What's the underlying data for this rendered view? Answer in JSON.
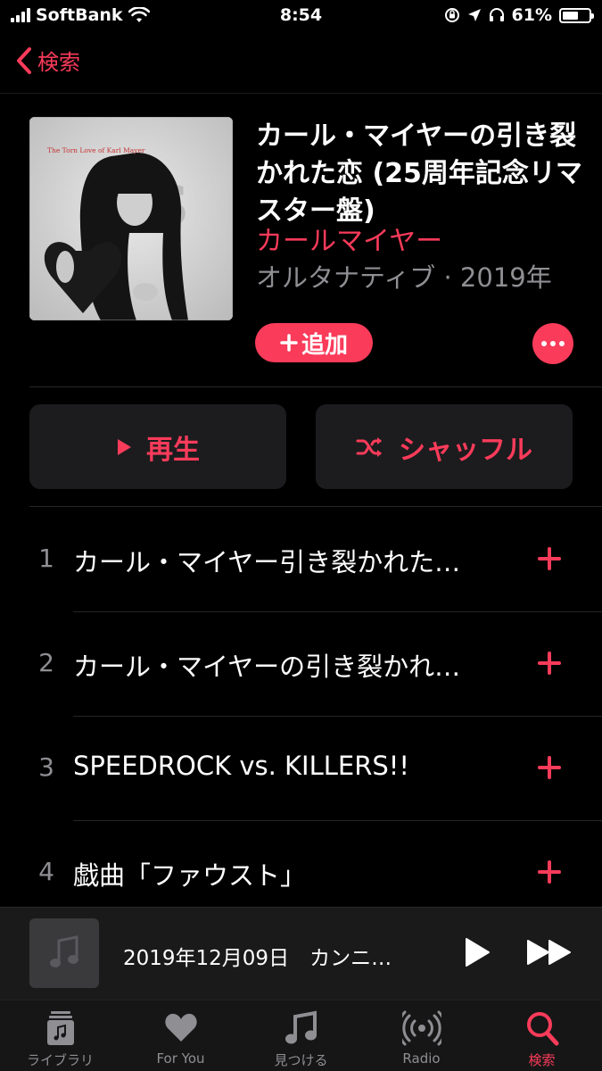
{
  "status_bar": {
    "carrier": "SoftBank",
    "time": "8:54",
    "battery": "61%",
    "battery_level": 0.61
  },
  "nav": {
    "back_label": "検索"
  },
  "album": {
    "title": "カール・マイヤーの引き裂かれた恋 (25周年記念リマスター盤)",
    "artist": "カールマイヤー",
    "meta": "オルタナティブ · 2019年",
    "add_label": "追加",
    "cover_text": "The Torn Love of Karl Mayer"
  },
  "actions": {
    "play_label": "再生",
    "shuffle_label": "シャッフル"
  },
  "tracks": [
    {
      "number": "1",
      "title": "カール・マイヤー引き裂かれた…"
    },
    {
      "number": "2",
      "title": "カール・マイヤーの引き裂かれ…"
    },
    {
      "number": "3",
      "title": "SPEEDROCK vs. KILLERS!!"
    },
    {
      "number": "4",
      "title": "戯曲「ファウスト」"
    }
  ],
  "mini_player": {
    "title": "2019年12月09日　カンニ…"
  },
  "tab_bar": [
    {
      "label": "ライブラリ",
      "icon": "library-icon",
      "active": false
    },
    {
      "label": "For You",
      "icon": "heart-icon",
      "active": false
    },
    {
      "label": "見つける",
      "icon": "music-note-icon",
      "active": false
    },
    {
      "label": "Radio",
      "icon": "radio-icon",
      "active": false
    },
    {
      "label": "検索",
      "icon": "search-icon",
      "active": true
    }
  ],
  "colors": {
    "accent": "#fa3b5a",
    "background": "#000000",
    "secondary_text": "#8e8e93",
    "button_bg": "#1c1c1e"
  }
}
